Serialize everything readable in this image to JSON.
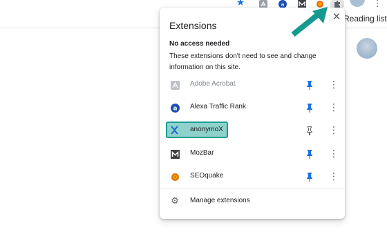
{
  "toolbar": {
    "icons": [
      "bookmark-star-icon",
      "adobe-acrobat-icon",
      "alexa-icon",
      "mozbar-icon",
      "seoquake-icon",
      "extensions-puzzle-icon",
      "profile-avatar",
      "browser-menu-icon"
    ],
    "menu_glyph": "⋮"
  },
  "bookmarks_bar": {
    "reading_list": "Reading list"
  },
  "extensions_popup": {
    "title": "Extensions",
    "close_glyph": "✕",
    "section_heading": "No access needed",
    "section_description": "These extensions don't need to see and change information on this site.",
    "items": [
      {
        "name": "Adobe Acrobat",
        "icon": "adobe-acrobat-icon",
        "pinned": true,
        "enabled": false
      },
      {
        "name": "Alexa Traffic Rank",
        "icon": "alexa-icon",
        "pinned": true,
        "enabled": true
      },
      {
        "name": "anonymoX",
        "icon": "anonymox-icon",
        "pinned": false,
        "enabled": true,
        "highlighted": true
      },
      {
        "name": "MozBar",
        "icon": "mozbar-icon",
        "pinned": true,
        "enabled": true
      },
      {
        "name": "SEOquake",
        "icon": "seoquake-icon",
        "pinned": true,
        "enabled": true
      }
    ],
    "more_glyph": "⋮",
    "manage_label": "Manage extensions"
  },
  "colors": {
    "accent_blue": "#1a73e8",
    "highlight_teal": "#199c93",
    "highlight_fill": "#8fd2cc",
    "arrow_teal": "#159a8f"
  }
}
